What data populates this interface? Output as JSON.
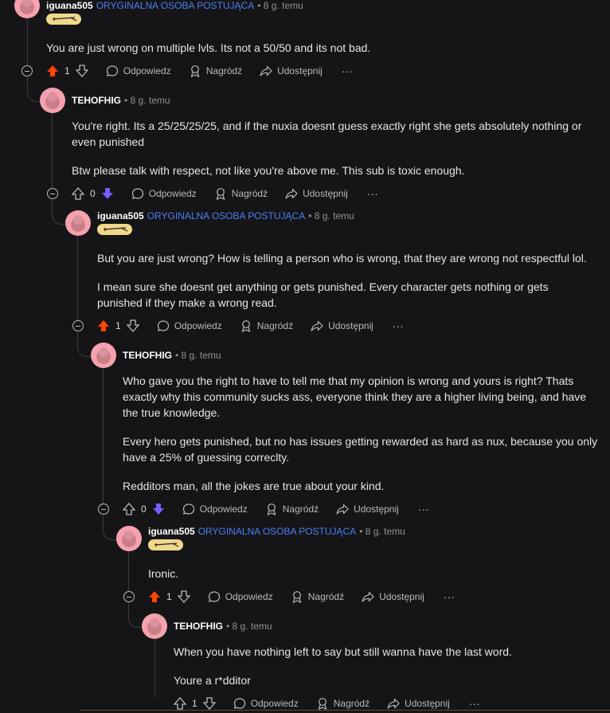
{
  "comments": [
    {
      "author": "iguana505",
      "op_label": "ORYGINALNA OSOBA POSTUJĄCA",
      "time": "• 8 g. temu",
      "paragraphs": [
        "You are just wrong on multiple lvls. Its not a 50/50 and its not bad."
      ],
      "vote": "up",
      "score": "1"
    },
    {
      "author": "TEHOFHIG",
      "time": "• 8 g. temu",
      "paragraphs": [
        "You're right. Its a 25/25/25/25, and if the nuxia doesnt guess exactly right she gets absolutely nothing or even punished",
        "Btw please talk with respect, not like you're above me. This sub is toxic enough."
      ],
      "vote": "down",
      "score": "0"
    },
    {
      "author": "iguana505",
      "op_label": "ORYGINALNA OSOBA POSTUJĄCA",
      "time": "• 8 g. temu",
      "paragraphs": [
        "But you are just wrong? How is telling a person who is wrong, that they are wrong not respectful lol.",
        "I mean sure she doesnt get anything or gets punished. Every character gets nothing or gets punished if they make a wrong read."
      ],
      "vote": "up",
      "score": "1"
    },
    {
      "author": "TEHOFHIG",
      "time": "• 8 g. temu",
      "paragraphs": [
        "Who gave you the right to have to tell me that my opinion is wrong and yours is right? Thats exactly why this community sucks ass, everyone think they are a higher living being, and have the true knowledge.",
        "Every hero gets punished, but no has issues getting rewarded as hard as nux, because you only have a 25% of guessing correclty.",
        "Redditors man, all the jokes are true about your kind."
      ],
      "vote": "down",
      "score": "0"
    },
    {
      "author": "iguana505",
      "op_label": "ORYGINALNA OSOBA POSTUJĄCA",
      "time": "• 8 g. temu",
      "paragraphs": [
        "Ironic."
      ],
      "vote": "up",
      "score": "1"
    },
    {
      "author": "TEHOFHIG",
      "time": "• 8 g. temu",
      "paragraphs": [
        "When you have nothing left to say but still wanna have the last word.",
        "Youre a r*dditor"
      ],
      "vote": "none",
      "score": "1"
    }
  ],
  "actions": {
    "reply": "Odpowiedz",
    "award": "Nagródź",
    "share": "Udostępnij",
    "more": "···"
  },
  "colors": {
    "upvote_active": "#ff4500",
    "downvote_active": "#7a5cff",
    "op_label": "#4c7ff6",
    "flair": "#f0d78a",
    "avatar": "#f5a2ae"
  },
  "icons": [
    "upvote-icon",
    "downvote-icon",
    "comment-icon",
    "award-icon",
    "share-icon",
    "collapse-icon",
    "more-icon",
    "avatar-icon"
  ]
}
